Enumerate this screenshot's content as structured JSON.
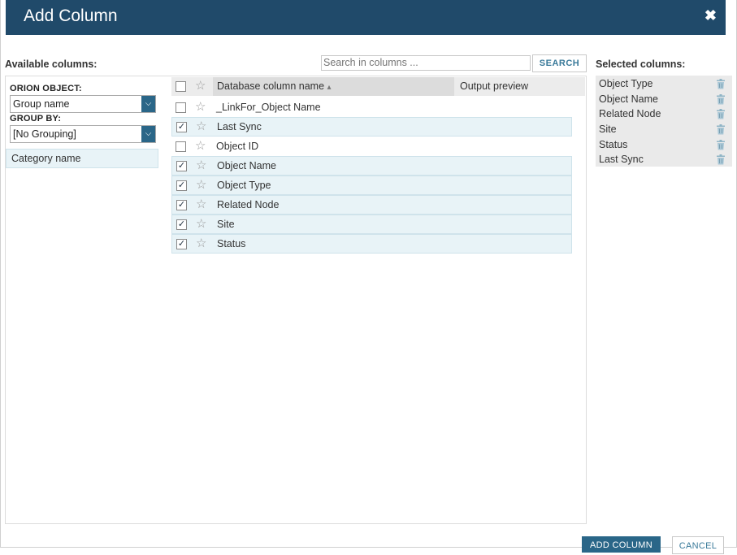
{
  "dialog": {
    "title": "Add Column",
    "close_glyph": "✖"
  },
  "available": {
    "label": "Available columns:"
  },
  "search": {
    "placeholder": "Search in columns ...",
    "button_label": "SEARCH"
  },
  "left": {
    "orion_label": "ORION OBJECT:",
    "orion_value": "Group name",
    "group_label": "GROUP BY:",
    "group_value": "[No Grouping]",
    "category": "Category name"
  },
  "grid": {
    "col_name": "Database column name",
    "sort_glyph": "▴",
    "col_output": "Output preview",
    "rows": [
      {
        "name": "_LinkFor_Object Name",
        "checked": false
      },
      {
        "name": "Last Sync",
        "checked": true
      },
      {
        "name": "Object ID",
        "checked": false
      },
      {
        "name": "Object Name",
        "checked": true
      },
      {
        "name": "Object Type",
        "checked": true
      },
      {
        "name": "Related Node",
        "checked": true
      },
      {
        "name": "Site",
        "checked": true
      },
      {
        "name": "Status",
        "checked": true
      }
    ]
  },
  "selected": {
    "label": "Selected columns:",
    "items": [
      "Object Type",
      "Object Name",
      "Related Node",
      "Site",
      "Status",
      "Last Sync"
    ]
  },
  "footer": {
    "add_label": "ADD COLUMN",
    "cancel_label": "CANCEL"
  },
  "colors": {
    "titlebar": "#204a6a",
    "accent": "#2a6688",
    "row_selected": "#e8f3f7"
  }
}
